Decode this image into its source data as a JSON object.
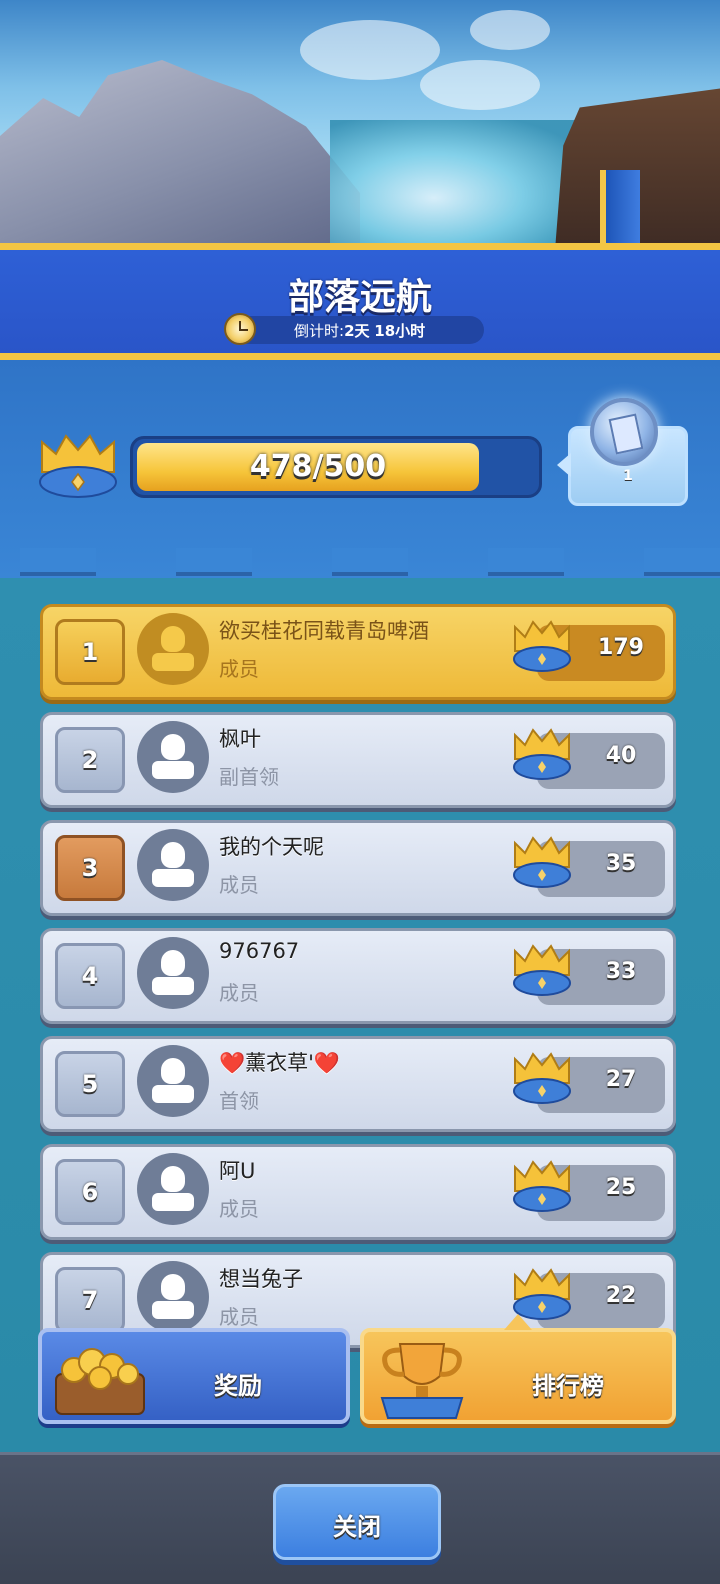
{
  "header": {
    "title": "部落远航",
    "countdown_label": "倒计时:",
    "countdown_days": "2天",
    "countdown_hours": "18小时"
  },
  "progress": {
    "text": "478/500",
    "current": 478,
    "max": 500,
    "reward_count": "1"
  },
  "members": [
    {
      "rank": "1",
      "name": "欲买桂花同载青岛啤酒",
      "role": "成员",
      "score": "179"
    },
    {
      "rank": "2",
      "name": "枫叶",
      "role": "副首领",
      "score": "40"
    },
    {
      "rank": "3",
      "name": "我的个天呢",
      "role": "成员",
      "score": "35"
    },
    {
      "rank": "4",
      "name": "976767",
      "role": "成员",
      "score": "33"
    },
    {
      "rank": "5",
      "name": "❤️薰衣草'❤️",
      "role": "首领",
      "score": "27"
    },
    {
      "rank": "6",
      "name": "阿U",
      "role": "成员",
      "score": "25"
    },
    {
      "rank": "7",
      "name": "想当兔子",
      "role": "成员",
      "score": "22"
    }
  ],
  "actions": {
    "rewards_label": "奖励",
    "leaderboard_label": "排行榜"
  },
  "footer": {
    "close_label": "关闭"
  },
  "colors": {
    "title_bar": "#2e60d6",
    "gold_accent": "#f3c543",
    "progress_fill": "#f6c53a",
    "row_first": "#f7d466",
    "row_default": "#dfe6f3",
    "list_background": "#2f8fb0"
  },
  "icons": {
    "clock": "clock-icon",
    "crown": "crown-icon",
    "reward_card": "card-coin-icon",
    "avatar": "avatar-icon",
    "chest": "treasure-chest-icon",
    "trophy": "trophy-icon"
  }
}
